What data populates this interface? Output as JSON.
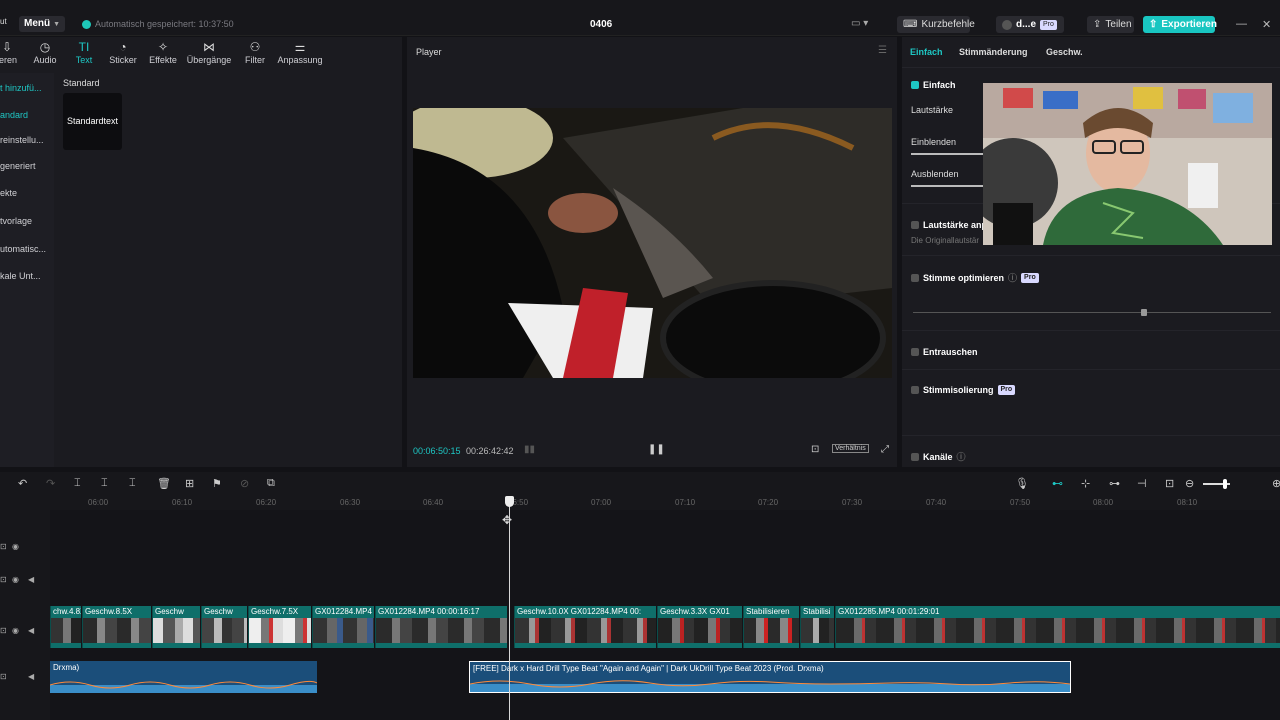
{
  "topbar": {
    "brand": "ut",
    "menu": "Menü",
    "autosave": "Automatisch gespeichert: 10:37:50",
    "project": "0406",
    "shortcuts": "Kurzbefehle",
    "user": "d...e",
    "pro": "Pro",
    "share": "Teilen",
    "export": "Exportieren"
  },
  "tools": [
    {
      "label": "ieren",
      "icon": "import-icon"
    },
    {
      "label": "Audio",
      "icon": "audio-icon"
    },
    {
      "label": "Text",
      "icon": "text-icon"
    },
    {
      "label": "Sticker",
      "icon": "sticker-icon"
    },
    {
      "label": "Effekte",
      "icon": "effects-icon"
    },
    {
      "label": "Übergänge",
      "icon": "transitions-icon"
    },
    {
      "label": "Filter",
      "icon": "filter-icon"
    },
    {
      "label": "Anpassung",
      "icon": "adjust-icon"
    }
  ],
  "sidenav": [
    "t hinzufü...",
    "andard",
    "reinstellu...",
    "generiert",
    "ekte",
    "tvorlage",
    "utomatisc...",
    "kale Unt..."
  ],
  "text_panel": {
    "category": "Standard",
    "card": "Standardtext"
  },
  "player": {
    "title": "Player",
    "current": "00:06:50:15",
    "total": "00:26:42:42",
    "ratio": "Verhältnis"
  },
  "right": {
    "tabs": [
      "Einfach",
      "Stimmänderung",
      "Geschw."
    ],
    "einfach": "Einfach",
    "lautstaerke": "Lautstärke",
    "einblenden": "Einblenden",
    "ausblenden": "Ausblenden",
    "normalize": "Lautstärke anp",
    "normalize_sub": "Die Originallautstär",
    "voice": "Stimme optimieren",
    "denoise": "Entrauschen",
    "isolate": "Stimmisolierung",
    "channels": "Kanäle",
    "pro": "Pro"
  },
  "ruler": [
    "06:00",
    "06:10",
    "06:20",
    "06:30",
    "06:40",
    "06:50",
    "07:00",
    "07:10",
    "07:20",
    "07:30",
    "07:40",
    "07:50",
    "08:00",
    "08:10"
  ],
  "video_clips": [
    {
      "label": "chw.4.8X"
    },
    {
      "label": "Geschw.8.5X"
    },
    {
      "label": "Geschw"
    },
    {
      "label": "Geschw"
    },
    {
      "label": "Geschw.7.5X"
    },
    {
      "label": "GX012284.MP4"
    },
    {
      "label": "GX012284.MP4  00:00:16:17"
    },
    {
      "label": "Geschw.10.0X  GX012284.MP4  00:"
    },
    {
      "label": "Geschw.3.3X  GX01"
    },
    {
      "label": "Stabilisieren"
    },
    {
      "label": "Stabilisi"
    },
    {
      "label": "GX012285.MP4  00:01:29:01"
    }
  ],
  "audio_clips": [
    {
      "label": "Drxma)"
    },
    {
      "label": "[FREE] Dark x Hard Drill Type Beat \"Again and Again\" | Dark UkDrill Type Beat 2023 (Prod. Drxma)"
    }
  ],
  "colors": {
    "accent": "#1ec7c4",
    "export": "#19c6c1",
    "video_clip": "#0f6f6a",
    "audio_clip": "#1b4e7a"
  }
}
